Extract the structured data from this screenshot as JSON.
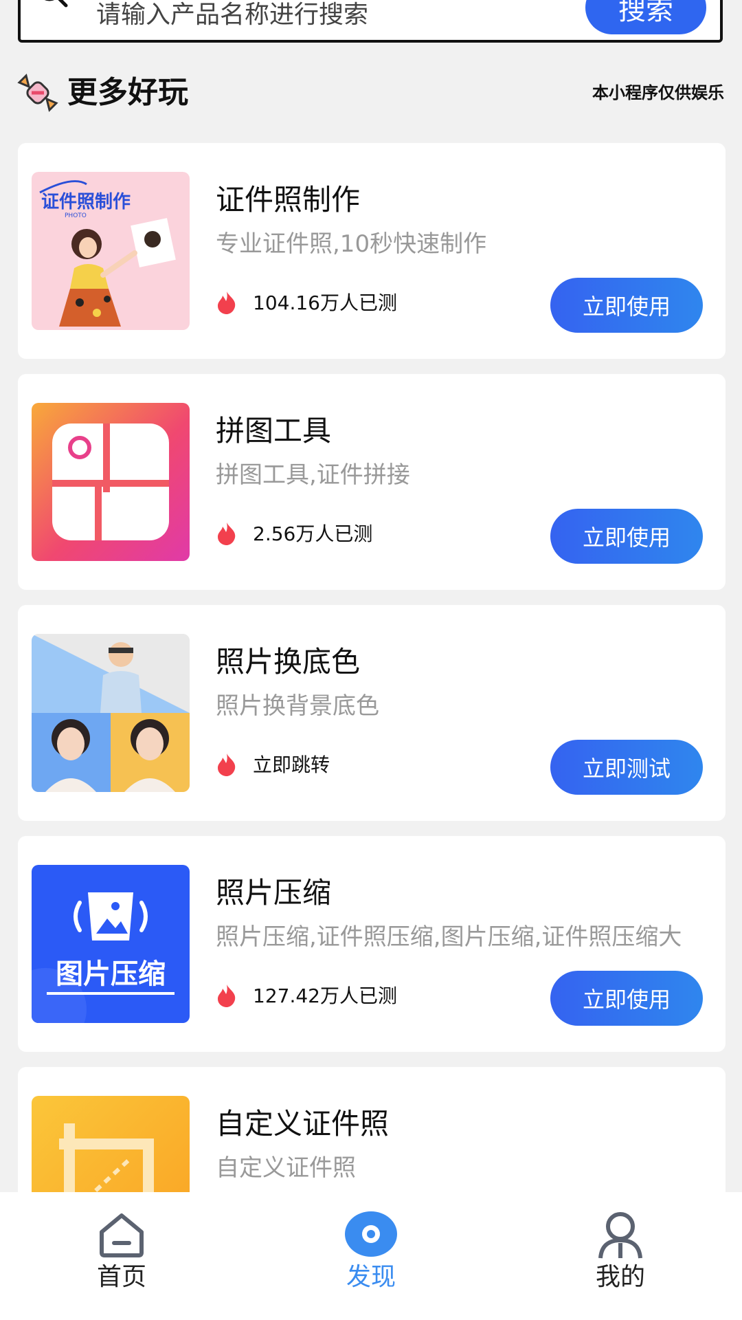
{
  "search": {
    "placeholder_text": "请输入产品名称进行搜索",
    "button_label": "搜索"
  },
  "section": {
    "title": "更多好玩",
    "note": "本小程序仅供娱乐"
  },
  "cards": [
    {
      "title": "证件照制作",
      "description": "专业证件照,10秒快速制作",
      "stat": "104.16万人已测",
      "button": "立即使用",
      "thumb_text": "证件照制作",
      "thumb_subtext": "PHOTO"
    },
    {
      "title": "拼图工具",
      "description": "拼图工具,证件拼接",
      "stat": "2.56万人已测",
      "button": "立即使用"
    },
    {
      "title": "照片换底色",
      "description": "照片换背景底色",
      "stat": "立即跳转",
      "button": "立即测试"
    },
    {
      "title": "照片压缩",
      "description": "照片压缩,证件照压缩,图片压缩,证件照压缩大",
      "stat": "127.42万人已测",
      "button": "立即使用",
      "thumb_text": "图片压缩"
    },
    {
      "title": "自定义证件照",
      "description": "自定义证件照"
    }
  ],
  "nav": {
    "items": [
      {
        "label": "首页",
        "icon": "home-icon",
        "active": false
      },
      {
        "label": "发现",
        "icon": "eye-icon",
        "active": true
      },
      {
        "label": "我的",
        "icon": "user-icon",
        "active": false
      }
    ]
  },
  "colors": {
    "accent": "#2f66f0",
    "nav_active": "#3a8cf0",
    "fire": "#f2404d",
    "desc_gray": "#999999",
    "background": "#f1f1f1"
  }
}
